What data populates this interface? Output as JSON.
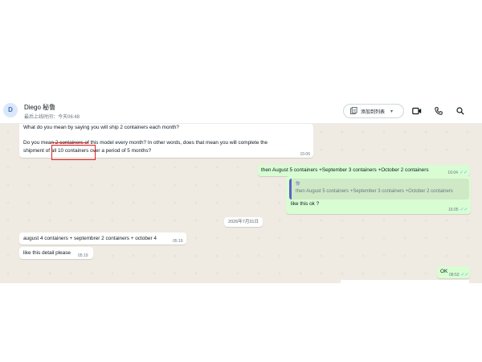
{
  "header": {
    "avatar_letter": "D",
    "contact_name": "Diego 秘鲁",
    "last_seen": "最后上线时间：今天06:48",
    "add_to_list_label": "添加到列表",
    "icons": [
      "list-add-icon",
      "chevron-down-icon",
      "video-call-icon",
      "phone-icon",
      "search-icon"
    ]
  },
  "messages": [
    {
      "direction": "in",
      "lines": [
        "What do you mean by saying you will ship 2 containers each month?",
        "",
        "Do you mean 2 containers of this model every month? In other words, does that mean you will complete the",
        "shipment of all 10 containers over a period of 5 months?"
      ],
      "time": "15:06"
    },
    {
      "direction": "out",
      "text": "then August 5 containers +September 3 containers  +October  2 containers",
      "time": "16:04"
    },
    {
      "direction": "out",
      "quote_author": "你",
      "quote_text": "then August 5 containers +September 3 containers  +October  2 containers",
      "text": "like this ok ?",
      "time": "16:05"
    },
    {
      "direction": "date",
      "text": "2026年7月31日"
    },
    {
      "direction": "in",
      "text": "august 4 containers +  septembrer 2 containers + october 4",
      "time": "05:19"
    },
    {
      "direction": "in",
      "text": "like this detail please",
      "time": "05:19"
    },
    {
      "direction": "out",
      "text": "OK",
      "time": "08:53"
    }
  ],
  "colors": {
    "incoming_bubble": "#ffffff",
    "outgoing_bubble": "#d9fdd3",
    "chat_background": "#efeae2",
    "read_ticks": "#53bdeb",
    "annotation_red": "#e02020",
    "quote_bar": "#5b63c2"
  }
}
